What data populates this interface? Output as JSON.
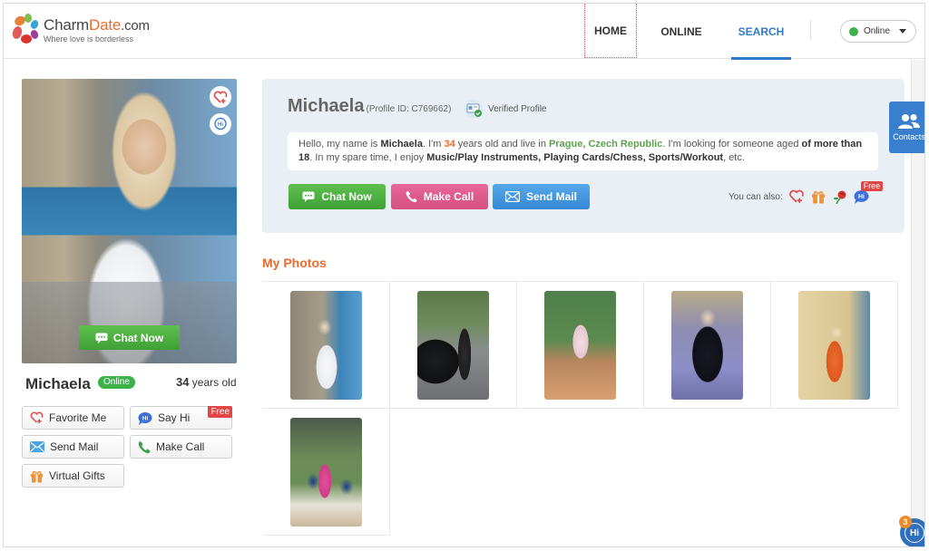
{
  "header": {
    "brand_main": "Charm",
    "brand_accent": "Date",
    "brand_suffix": ".com",
    "tagline": "Where love is borderless",
    "nav": [
      {
        "label": "HOME",
        "active": false
      },
      {
        "label": "ONLINE",
        "active": false
      },
      {
        "label": "SEARCH",
        "active": true
      }
    ],
    "status_select": {
      "value": "Online",
      "dot_color": "#3cb34a"
    }
  },
  "profile_card": {
    "photo_alt": "Main profile photo",
    "favorite_icon": "heart-plus-icon",
    "say_hi_icon": "hi-bubble-icon",
    "chat_now_label": "Chat Now",
    "name": "Michaela",
    "online_badge": "Online",
    "age_number": "34",
    "age_suffix": " years old",
    "actions": [
      {
        "label": "Favorite Me",
        "icon": "heart-plus-icon"
      },
      {
        "label": "Say Hi",
        "icon": "hi-bubble-icon",
        "badge": "Free"
      },
      {
        "label": "Send Mail",
        "icon": "mail-icon"
      },
      {
        "label": "Make Call",
        "icon": "phone-icon"
      },
      {
        "label": "Virtual Gifts",
        "icon": "gift-icon"
      }
    ]
  },
  "profile_panel": {
    "name": "Michaela",
    "profile_id": "(Profile ID: C769662)",
    "verified_label": "Verified Profile",
    "bio": {
      "p1": "Hello, my name is ",
      "name": "Michaela",
      "p2": ". I'm ",
      "age": "34",
      "p3": " years old and live in ",
      "location": "Prague, Czech Republic",
      "p4": ". I'm looking for someone aged ",
      "seeking": "of more than 18",
      "p5": ". In my spare time, I enjoy ",
      "interests": "Music/Play Instruments, Playing Cards/Chess, Sports/Workout",
      "p6": ", etc."
    },
    "buttons": {
      "chat": "Chat Now",
      "call": "Make Call",
      "mail": "Send Mail"
    },
    "you_can_also": "You can also:",
    "also_icons": [
      "heart-plus-icon",
      "gift-icon",
      "rose-icon",
      "hi-bubble-icon"
    ],
    "also_free_badge": "Free"
  },
  "photos": {
    "title": "My Photos",
    "items": [
      {
        "desc": "White dress on seaside terrace"
      },
      {
        "desc": "Black outfit next to black SUV"
      },
      {
        "desc": "Pink dress on garden path"
      },
      {
        "desc": "Black outfit on purple sofa"
      },
      {
        "desc": "Orange dress by wall"
      },
      {
        "desc": "Pink dress sitting on bench"
      }
    ]
  },
  "side": {
    "contacts_label": "Contacts",
    "hi_label": "Hi",
    "hi_count": "3"
  },
  "colors": {
    "brand_orange": "#ef6a2c",
    "link_blue": "#2f7ac6",
    "online_green": "#3cb34a",
    "chat_green": "#4cb040",
    "call_pink": "#de5c8c",
    "mail_blue": "#449ae0",
    "free_red": "#e04646"
  }
}
